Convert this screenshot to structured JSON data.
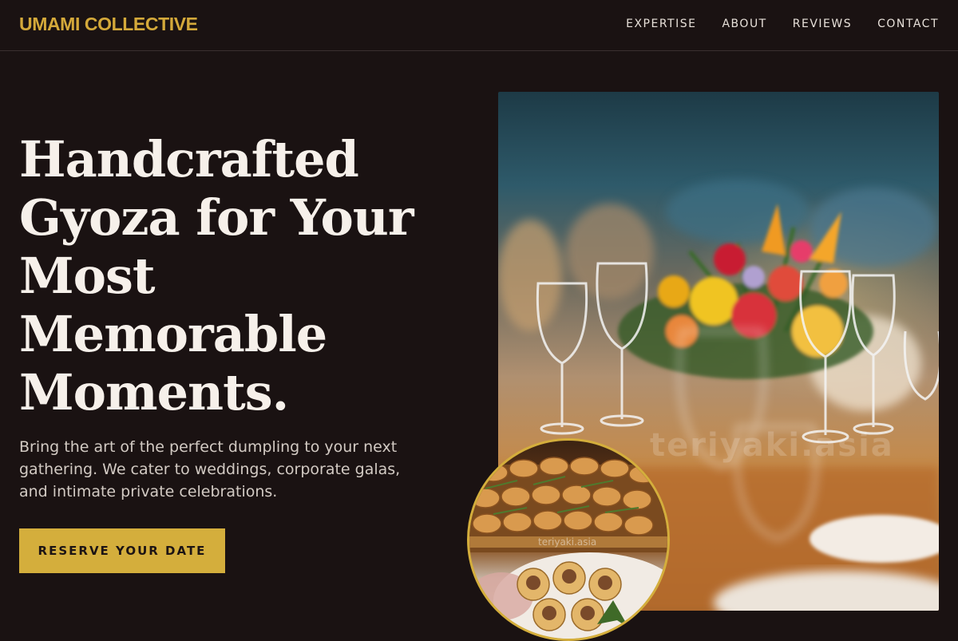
{
  "header": {
    "brand": "UMAMI COLLECTIVE",
    "nav": [
      "EXPERTISE",
      "ABOUT",
      "REVIEWS",
      "CONTACT"
    ]
  },
  "hero": {
    "headline": "Handcrafted Gyoza for Your Most Memorable Moments.",
    "subtext": "Bring the art of the perfect dumpling to your next gathering. We cater to weddings, corporate galas, and intimate private celebrations.",
    "cta_label": "RESERVE YOUR DATE"
  },
  "images": {
    "main_photo": "banquet-table-flowers-photo",
    "main_watermark": "teriyaki.asia",
    "inset_photo": "dumpling-platter-photo",
    "inset_watermark": "teriyaki.asia"
  },
  "colors": {
    "background": "#1a1212",
    "accent": "#d4ae3c",
    "text": "#f6f0ea"
  }
}
